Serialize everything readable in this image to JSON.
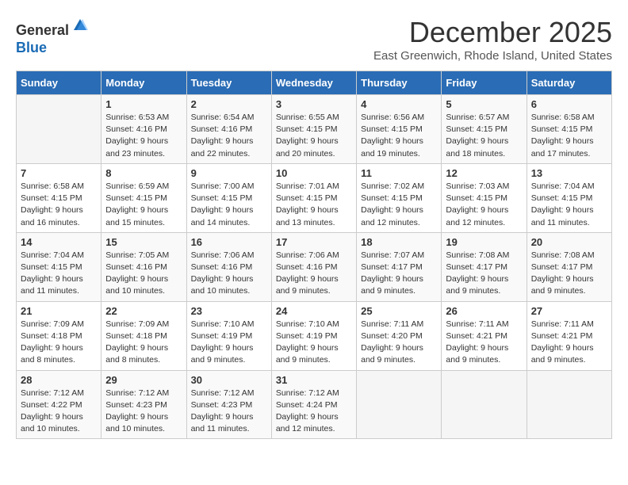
{
  "header": {
    "logo_line1": "General",
    "logo_line2": "Blue",
    "month": "December 2025",
    "location": "East Greenwich, Rhode Island, United States"
  },
  "weekdays": [
    "Sunday",
    "Monday",
    "Tuesday",
    "Wednesday",
    "Thursday",
    "Friday",
    "Saturday"
  ],
  "weeks": [
    [
      {
        "day": "",
        "info": ""
      },
      {
        "day": "1",
        "info": "Sunrise: 6:53 AM\nSunset: 4:16 PM\nDaylight: 9 hours\nand 23 minutes."
      },
      {
        "day": "2",
        "info": "Sunrise: 6:54 AM\nSunset: 4:16 PM\nDaylight: 9 hours\nand 22 minutes."
      },
      {
        "day": "3",
        "info": "Sunrise: 6:55 AM\nSunset: 4:15 PM\nDaylight: 9 hours\nand 20 minutes."
      },
      {
        "day": "4",
        "info": "Sunrise: 6:56 AM\nSunset: 4:15 PM\nDaylight: 9 hours\nand 19 minutes."
      },
      {
        "day": "5",
        "info": "Sunrise: 6:57 AM\nSunset: 4:15 PM\nDaylight: 9 hours\nand 18 minutes."
      },
      {
        "day": "6",
        "info": "Sunrise: 6:58 AM\nSunset: 4:15 PM\nDaylight: 9 hours\nand 17 minutes."
      }
    ],
    [
      {
        "day": "7",
        "info": "Sunrise: 6:58 AM\nSunset: 4:15 PM\nDaylight: 9 hours\nand 16 minutes."
      },
      {
        "day": "8",
        "info": "Sunrise: 6:59 AM\nSunset: 4:15 PM\nDaylight: 9 hours\nand 15 minutes."
      },
      {
        "day": "9",
        "info": "Sunrise: 7:00 AM\nSunset: 4:15 PM\nDaylight: 9 hours\nand 14 minutes."
      },
      {
        "day": "10",
        "info": "Sunrise: 7:01 AM\nSunset: 4:15 PM\nDaylight: 9 hours\nand 13 minutes."
      },
      {
        "day": "11",
        "info": "Sunrise: 7:02 AM\nSunset: 4:15 PM\nDaylight: 9 hours\nand 12 minutes."
      },
      {
        "day": "12",
        "info": "Sunrise: 7:03 AM\nSunset: 4:15 PM\nDaylight: 9 hours\nand 12 minutes."
      },
      {
        "day": "13",
        "info": "Sunrise: 7:04 AM\nSunset: 4:15 PM\nDaylight: 9 hours\nand 11 minutes."
      }
    ],
    [
      {
        "day": "14",
        "info": "Sunrise: 7:04 AM\nSunset: 4:15 PM\nDaylight: 9 hours\nand 11 minutes."
      },
      {
        "day": "15",
        "info": "Sunrise: 7:05 AM\nSunset: 4:16 PM\nDaylight: 9 hours\nand 10 minutes."
      },
      {
        "day": "16",
        "info": "Sunrise: 7:06 AM\nSunset: 4:16 PM\nDaylight: 9 hours\nand 10 minutes."
      },
      {
        "day": "17",
        "info": "Sunrise: 7:06 AM\nSunset: 4:16 PM\nDaylight: 9 hours\nand 9 minutes."
      },
      {
        "day": "18",
        "info": "Sunrise: 7:07 AM\nSunset: 4:17 PM\nDaylight: 9 hours\nand 9 minutes."
      },
      {
        "day": "19",
        "info": "Sunrise: 7:08 AM\nSunset: 4:17 PM\nDaylight: 9 hours\nand 9 minutes."
      },
      {
        "day": "20",
        "info": "Sunrise: 7:08 AM\nSunset: 4:17 PM\nDaylight: 9 hours\nand 9 minutes."
      }
    ],
    [
      {
        "day": "21",
        "info": "Sunrise: 7:09 AM\nSunset: 4:18 PM\nDaylight: 9 hours\nand 8 minutes."
      },
      {
        "day": "22",
        "info": "Sunrise: 7:09 AM\nSunset: 4:18 PM\nDaylight: 9 hours\nand 8 minutes."
      },
      {
        "day": "23",
        "info": "Sunrise: 7:10 AM\nSunset: 4:19 PM\nDaylight: 9 hours\nand 9 minutes."
      },
      {
        "day": "24",
        "info": "Sunrise: 7:10 AM\nSunset: 4:19 PM\nDaylight: 9 hours\nand 9 minutes."
      },
      {
        "day": "25",
        "info": "Sunrise: 7:11 AM\nSunset: 4:20 PM\nDaylight: 9 hours\nand 9 minutes."
      },
      {
        "day": "26",
        "info": "Sunrise: 7:11 AM\nSunset: 4:21 PM\nDaylight: 9 hours\nand 9 minutes."
      },
      {
        "day": "27",
        "info": "Sunrise: 7:11 AM\nSunset: 4:21 PM\nDaylight: 9 hours\nand 9 minutes."
      }
    ],
    [
      {
        "day": "28",
        "info": "Sunrise: 7:12 AM\nSunset: 4:22 PM\nDaylight: 9 hours\nand 10 minutes."
      },
      {
        "day": "29",
        "info": "Sunrise: 7:12 AM\nSunset: 4:23 PM\nDaylight: 9 hours\nand 10 minutes."
      },
      {
        "day": "30",
        "info": "Sunrise: 7:12 AM\nSunset: 4:23 PM\nDaylight: 9 hours\nand 11 minutes."
      },
      {
        "day": "31",
        "info": "Sunrise: 7:12 AM\nSunset: 4:24 PM\nDaylight: 9 hours\nand 12 minutes."
      },
      {
        "day": "",
        "info": ""
      },
      {
        "day": "",
        "info": ""
      },
      {
        "day": "",
        "info": ""
      }
    ]
  ]
}
